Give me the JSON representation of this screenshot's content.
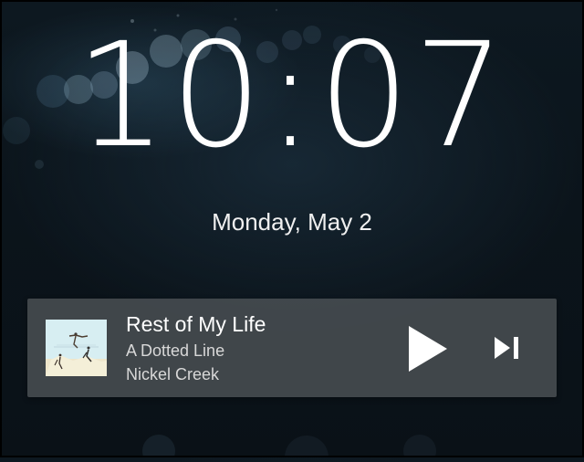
{
  "lockscreen": {
    "time_hours": "10",
    "time_separator": ":",
    "time_minutes": "07",
    "date": "Monday, May 2"
  },
  "media": {
    "title": "Rest of My Life",
    "album": "A Dotted Line",
    "artist": "Nickel Creek",
    "icons": {
      "art": "album-art-thumbnail",
      "play": "play-icon",
      "next": "skip-next-icon"
    }
  },
  "colors": {
    "background": "#0b141b",
    "text": "#ffffff",
    "card": "#505458"
  }
}
